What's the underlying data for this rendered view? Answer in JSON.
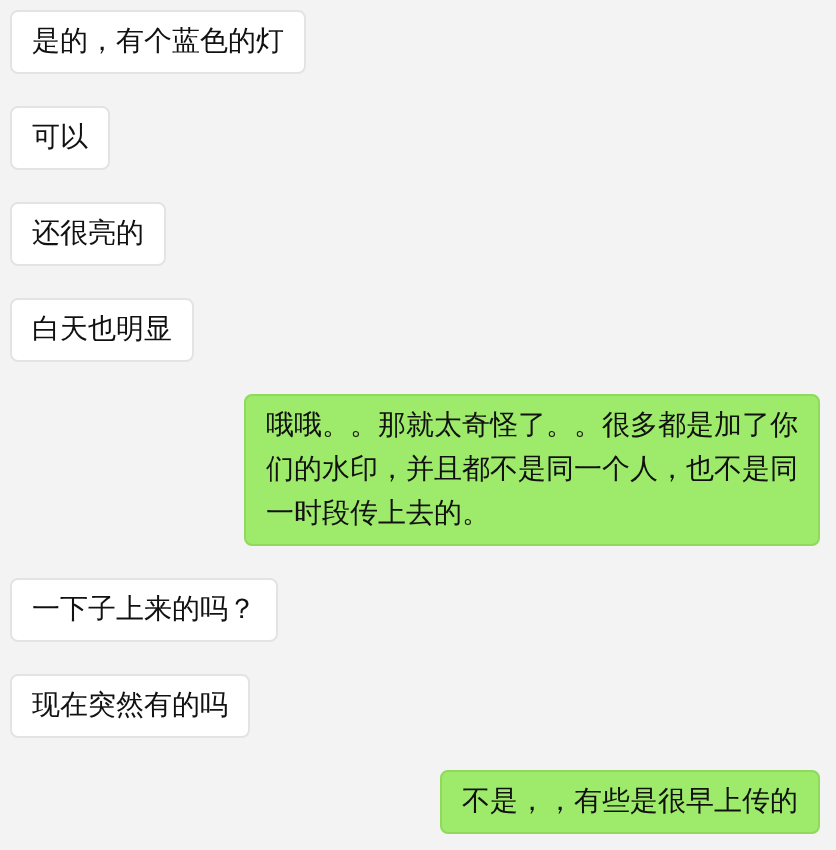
{
  "messages": [
    {
      "kind": "received",
      "text": "是的，有个蓝色的灯"
    },
    {
      "kind": "received",
      "text": "可以"
    },
    {
      "kind": "received",
      "text": "还很亮的"
    },
    {
      "kind": "received",
      "text": "白天也明显"
    },
    {
      "kind": "sent",
      "text": "哦哦。。那就太奇怪了。。很多都是加了你们的水印，并且都不是同一个人，也不是同一时段传上去的。"
    },
    {
      "kind": "received",
      "text": "一下子上来的吗？"
    },
    {
      "kind": "received",
      "text": "现在突然有的吗"
    },
    {
      "kind": "sent",
      "text": "不是，，有些是很早上传的"
    }
  ]
}
